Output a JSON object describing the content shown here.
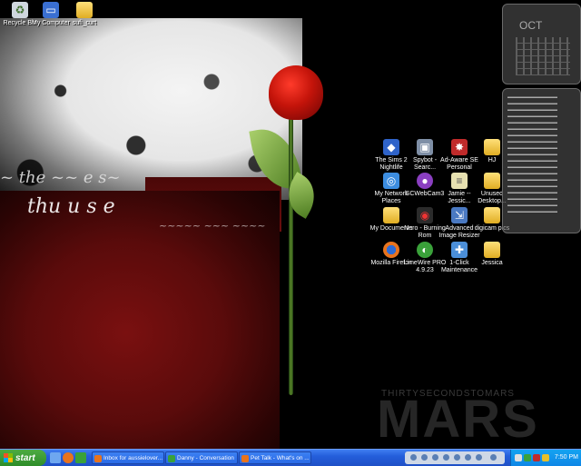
{
  "desktop": {
    "icons_top": [
      {
        "id": "recycle",
        "label": "Recycle Bin"
      },
      {
        "id": "mycomputer",
        "label": "My Computer"
      },
      {
        "id": "sufi",
        "label": "sufi_curt"
      }
    ],
    "icons_grid": [
      {
        "id": "sims",
        "label": "The Sims 2\nNightlife"
      },
      {
        "id": "spybot",
        "label": "Spybot -\nSearc..."
      },
      {
        "id": "adaware",
        "label": "Ad-Aware SE\nPersonal"
      },
      {
        "id": "hj",
        "label": "HJ"
      },
      {
        "id": "network",
        "label": "My Network\nPlaces"
      },
      {
        "id": "scwebcam",
        "label": "SCWebCam3"
      },
      {
        "id": "jamie",
        "label": "Jamie --\nJessic..."
      },
      {
        "id": "unused",
        "label": "Unused\nDesktop..."
      },
      {
        "id": "mydocs",
        "label": "My Documents"
      },
      {
        "id": "nero",
        "label": "Nero - Burning\nRom"
      },
      {
        "id": "resizer",
        "label": "Advanced\nImage Resizer"
      },
      {
        "id": "digicam",
        "label": "digicam pics"
      },
      {
        "id": "firefox",
        "label": "Mozilla Firefox"
      },
      {
        "id": "limewire",
        "label": "LimeWire PRO\n4.9.23"
      },
      {
        "id": "oneclick",
        "label": "1-Click\nMaintenance"
      },
      {
        "id": "jessica",
        "label": "Jessica"
      }
    ],
    "calendar_widget": {
      "month": "OCT"
    },
    "wallpaper": {
      "band": "THIRTYSECONDSTOMARS",
      "logo": "MARS"
    }
  },
  "taskbar": {
    "start_label": "start",
    "tasks": [
      {
        "id": "inbox",
        "label": "Inbox for aussielover..."
      },
      {
        "id": "danny",
        "label": "Danny - Conversation"
      },
      {
        "id": "pettalk",
        "label": "Pet Talk - What's on ..."
      }
    ],
    "clock": "7:50 PM"
  },
  "colors": {
    "taskbar": "#245edb",
    "start": "#2e8d29",
    "tray": "#0e86e6"
  }
}
